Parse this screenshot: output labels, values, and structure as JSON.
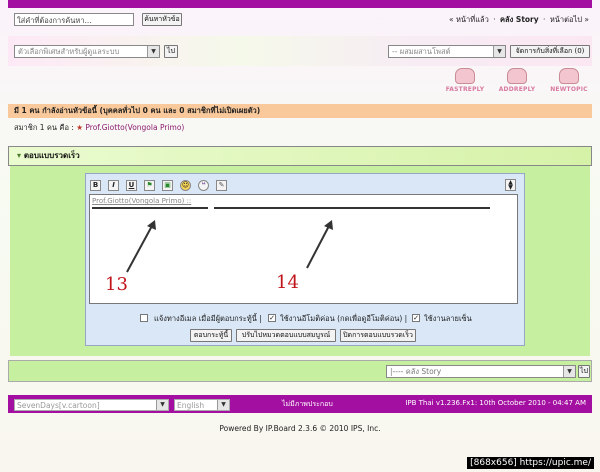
{
  "search": {
    "placeholder": "ใส่คำที่ต้องการค้นหา...",
    "button": "ค้นหาหัวข้อ"
  },
  "topnav": {
    "prev": "« หน้าที่แล้ว",
    "sep1": "·",
    "story": "คลัง Story",
    "sep2": "·",
    "next": "หน้าต่อไป »"
  },
  "mod": {
    "options": "ตัวเลือกพิเศษสำหรับผู้ดูแลระบบ",
    "go": "ไป",
    "mix": "-- ผสมผสานโพสต์",
    "manage": "จัดการกับสิ่งที่เลือก (0)"
  },
  "buttons": {
    "fastreply": "FASTREPLY",
    "addreply": "ADDREPLY",
    "newtopic": "NEWTOPIC"
  },
  "info": {
    "reading": "มี 1 คน กำลังอ่านหัวข้อนี้ (บุคคลทั่วไป 0 คน และ 0 สมาชิกที่ไม่เปิดเผยตัว)",
    "members_prefix": "สมาชิก 1 คน คือ :",
    "member_name": "Prof.Giotto(Vongola Primo)"
  },
  "quickreply": {
    "title": "ตอบแบบรวดเร็ว",
    "quote_text": "Prof.Giotto(Vongola Primo) ::"
  },
  "toolbar": [
    "B",
    "I",
    "U",
    "",
    "",
    "",
    "",
    ""
  ],
  "annotations": {
    "n13": "13",
    "n14": "14"
  },
  "options": {
    "email": "แจ้งทางอีเมล เมื่อมีผู้ตอบกระทู้นี้ |",
    "emoticons": "ใช้งานอีโมติค่อน (กดเพื่อดูอีโมติค่อน) |",
    "signature": "ใช้งานลายเซ็น"
  },
  "actions": {
    "post": "ตอบกระทู้นี้",
    "full": "ปรับไปหมวดตอบแบบสมบูรณ์",
    "close": "ปิดการตอบแบบรวดเร็ว"
  },
  "jump": {
    "select": "|---- คลัง Story",
    "go": "ไป"
  },
  "footer": {
    "skin": "SevenDays[v.cartoon]",
    "lang": "English",
    "center": "ไม่มีภาพประกอบ",
    "version": "IPB Thai v1.236.Fx1: 10th October 2010 - 04:47 AM"
  },
  "powered": "Powered By IP.Board 2.3.6 © 2010  IPS, Inc.",
  "watermark": "[868x656] https://upic.me/"
}
